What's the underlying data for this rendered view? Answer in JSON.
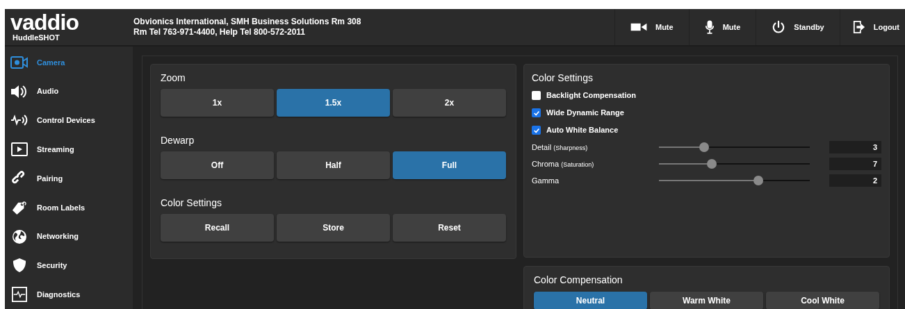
{
  "header": {
    "logo": "vaddio",
    "product": "HuddleSHOT",
    "info_line_1": "Obvionics International, SMH Business Solutions Rm 308",
    "info_line_2": "Rm Tel 763-971-4400, Help Tel 800-572-2011",
    "actions": [
      {
        "label": "Mute"
      },
      {
        "label": "Mute"
      },
      {
        "label": "Standby"
      },
      {
        "label": "Logout"
      }
    ]
  },
  "sidebar": {
    "items": [
      {
        "label": "Camera",
        "selected": true
      },
      {
        "label": "Audio",
        "selected": false
      },
      {
        "label": "Control Devices",
        "selected": false
      },
      {
        "label": "Streaming",
        "selected": false
      },
      {
        "label": "Pairing",
        "selected": false
      },
      {
        "label": "Room Labels",
        "selected": false
      },
      {
        "label": "Networking",
        "selected": false
      },
      {
        "label": "Security",
        "selected": false
      },
      {
        "label": "Diagnostics",
        "selected": false
      }
    ]
  },
  "camera_panel": {
    "groups": [
      {
        "title": "Zoom",
        "buttons": [
          {
            "label": "1x",
            "selected": false
          },
          {
            "label": "1.5x",
            "selected": true
          },
          {
            "label": "2x",
            "selected": false
          }
        ]
      },
      {
        "title": "Dewarp",
        "buttons": [
          {
            "label": "Off",
            "selected": false
          },
          {
            "label": "Half",
            "selected": false
          },
          {
            "label": "Full",
            "selected": true
          }
        ]
      },
      {
        "title": "Color Settings",
        "buttons": [
          {
            "label": "Recall",
            "selected": false
          },
          {
            "label": "Store",
            "selected": false
          },
          {
            "label": "Reset",
            "selected": false
          }
        ]
      }
    ]
  },
  "color_settings": {
    "title": "Color Settings",
    "checkboxes": [
      {
        "label": "Backlight Compensation",
        "checked": false
      },
      {
        "label": "Wide Dynamic Range",
        "checked": true
      },
      {
        "label": "Auto White Balance",
        "checked": true
      }
    ],
    "sliders": [
      {
        "label": "Detail",
        "note": "(Sharpness)",
        "level": 0.3,
        "value": "3"
      },
      {
        "label": "Chroma",
        "note": "(Saturation)",
        "level": 0.35,
        "value": "7"
      },
      {
        "label": "Gamma",
        "level": 0.66,
        "value": "2"
      }
    ]
  },
  "color_compensation": {
    "title": "Color Compensation",
    "buttons": [
      {
        "label": "Neutral",
        "selected": true
      },
      {
        "label": "Warm White",
        "selected": false
      },
      {
        "label": "Cool White",
        "selected": false
      }
    ]
  }
}
